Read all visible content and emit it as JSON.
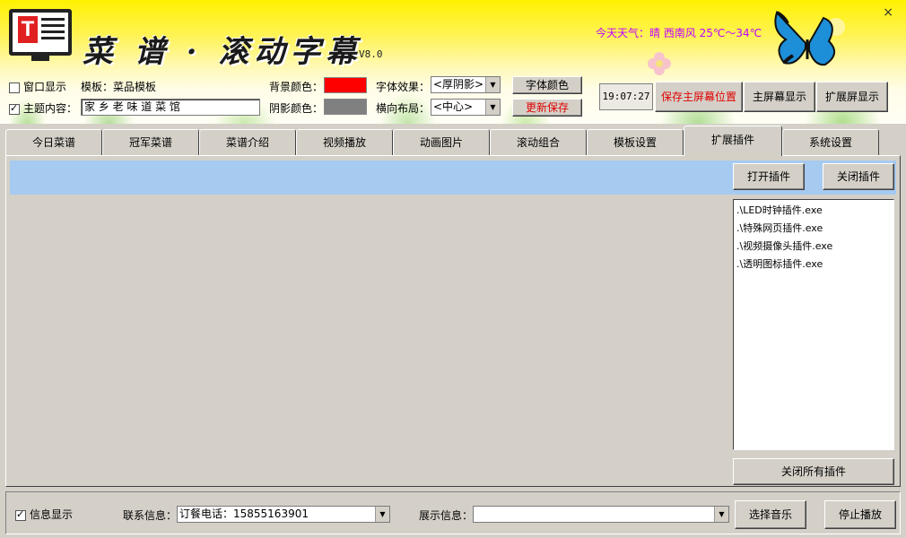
{
  "app": {
    "title": "菜 谱 · 滚动字幕",
    "version": "V8.0",
    "weather": "今天天气：晴  西南风  25℃～34℃",
    "close_glyph": "×",
    "logo_letter": "T"
  },
  "header": {
    "window_display_label": "窗口显示",
    "template_label": "模板：菜品模板",
    "subject_label": "主题内容：",
    "subject_value": "家 乡 老 味 道 菜 馆",
    "bg_color_label": "背景颜色：",
    "bg_color": "#ff0000",
    "shadow_color_label": "阴影颜色：",
    "shadow_color": "#808080",
    "font_effect_label": "字体效果：",
    "font_effect_value": "<厚阴影>",
    "layout_label": "横向布局：",
    "layout_value": "<中心>",
    "font_color_button": "字体颜色",
    "update_save_button": "更新保存",
    "clock": "19:07:27",
    "save_position_button": "保存主屏幕位置",
    "main_screen_button": "主屏幕显示",
    "ext_screen_button": "扩展屏显示"
  },
  "tabs": [
    {
      "label": "今日菜谱"
    },
    {
      "label": "冠军菜谱"
    },
    {
      "label": "菜谱介绍"
    },
    {
      "label": "视频播放"
    },
    {
      "label": "动画图片"
    },
    {
      "label": "滚动组合"
    },
    {
      "label": "模板设置"
    },
    {
      "label": "扩展插件"
    },
    {
      "label": "系统设置"
    }
  ],
  "active_tab": "扩展插件",
  "plugins": {
    "open_button": "打开插件",
    "close_button": "关闭插件",
    "close_all_button": "关闭所有插件",
    "items": [
      ".\\LED时钟插件.exe",
      ".\\特殊网页插件.exe",
      ".\\视频摄像头插件.exe",
      ".\\透明图标插件.exe"
    ]
  },
  "footer": {
    "info_display_label": "信息显示",
    "contact_label": "联系信息：",
    "contact_value": "订餐电话：15855163901",
    "display_info_label": "展示信息：",
    "display_info_value": "",
    "select_music_button": "选择音乐",
    "stop_play_button": "停止播放"
  },
  "colors": {
    "accent_blue": "#a6caf0",
    "weather_text": "#c000ff",
    "red_text": "#e00000"
  }
}
